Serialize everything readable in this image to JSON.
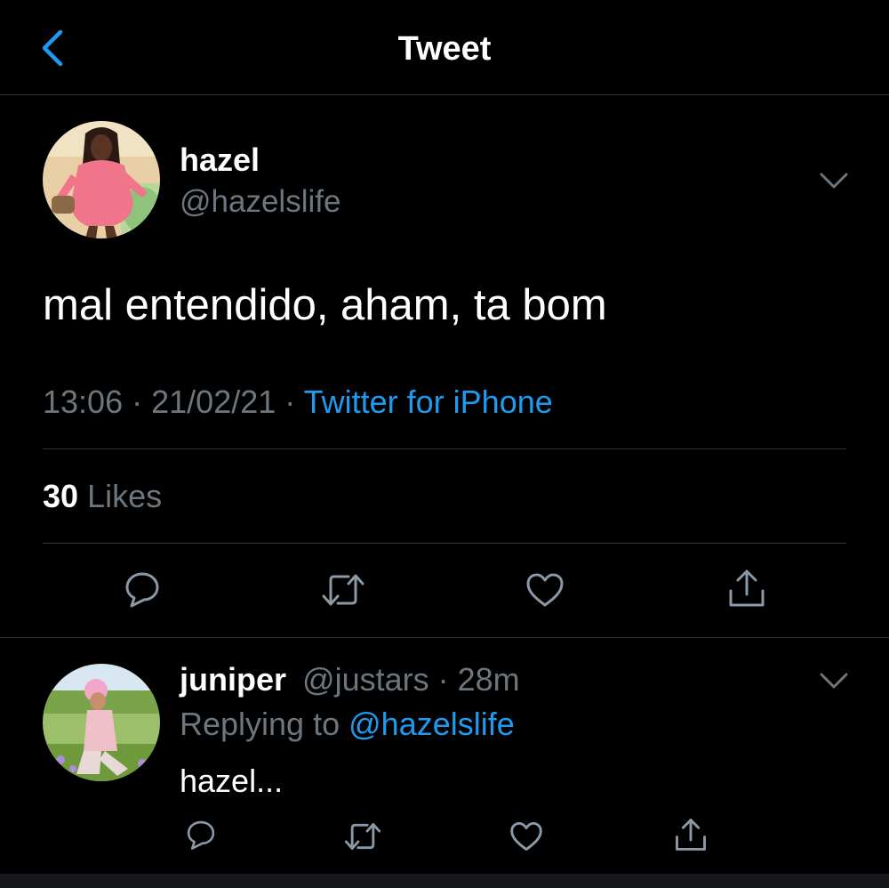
{
  "header": {
    "title": "Tweet",
    "back_icon": "chevron-left-icon"
  },
  "tweet": {
    "author_name": "hazel",
    "author_handle": "@hazelslife",
    "text": "mal entendido, aham, ta bom",
    "time": "13:06",
    "date": "21/02/21",
    "separator": "·",
    "source": "Twitter for iPhone",
    "likes_count": "30",
    "likes_label": "Likes",
    "actions": [
      "reply-icon",
      "retweet-icon",
      "like-icon",
      "share-icon"
    ]
  },
  "reply": {
    "author_name": "juniper",
    "author_handle": "@justars",
    "separator": "·",
    "age": "28m",
    "replying_to_label": "Replying to",
    "replying_to_handle": "@hazelslife",
    "text": "hazel...",
    "actions": [
      "reply-icon",
      "retweet-icon",
      "like-icon",
      "share-icon"
    ]
  },
  "colors": {
    "background": "#000000",
    "text": "#ffffff",
    "muted": "#6e767d",
    "accent": "#1d9bf0",
    "divider": "#2f3336"
  }
}
